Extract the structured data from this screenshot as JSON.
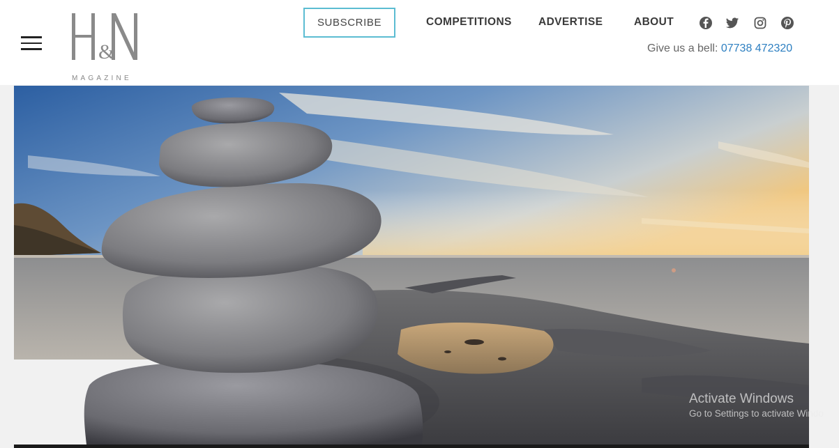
{
  "logo": {
    "monogram": "H&N",
    "wordmark": "MAGAZINE"
  },
  "menu": {
    "icon": "hamburger-menu-icon"
  },
  "nav": {
    "subscribe_label": "SUBSCRIBE",
    "competitions_label": "COMPETITIONS",
    "advertise_label": "ADVERTISE",
    "about_label": "ABOUT"
  },
  "social": [
    {
      "name": "facebook-icon"
    },
    {
      "name": "twitter-icon"
    },
    {
      "name": "instagram-icon"
    },
    {
      "name": "pinterest-icon"
    }
  ],
  "contact": {
    "prefix": "Give us a bell:",
    "phone": "07738 472320"
  },
  "hero": {
    "subject": "stacked pebbles on a rocky shore at sunset"
  },
  "watermark": {
    "line1": "Activate Windows",
    "line2": "Go to Settings to activate Windo"
  },
  "colors": {
    "accent_border": "#5bbcd2",
    "phone_link": "#2d7fc1",
    "nav_text": "#3a3a3a"
  }
}
